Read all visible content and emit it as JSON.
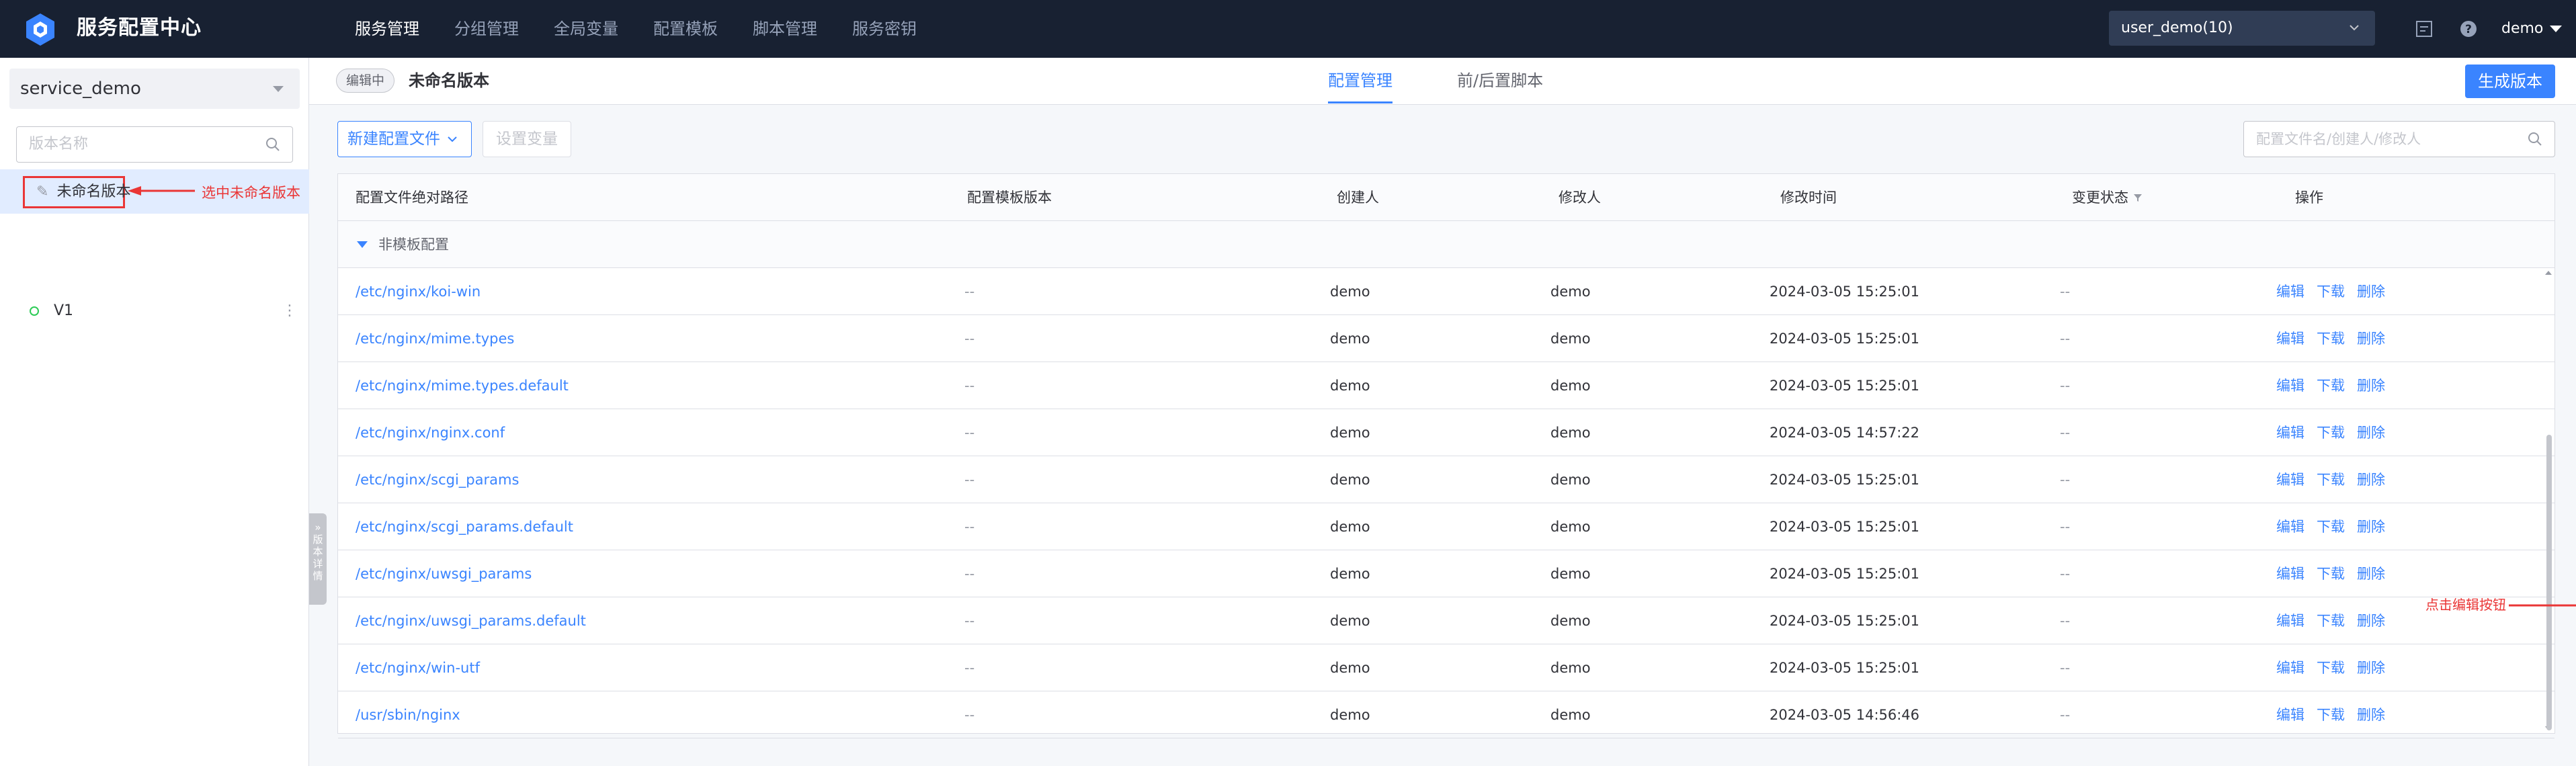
{
  "app": {
    "title": "服务配置中心"
  },
  "nav": {
    "items": [
      "服务管理",
      "分组管理",
      "全局变量",
      "配置模板",
      "脚本管理",
      "服务密钥"
    ],
    "active_index": 0
  },
  "topbar": {
    "business": "user_demo(10)",
    "user": "demo",
    "icons": [
      "doc-icon",
      "help-icon"
    ]
  },
  "sidebar": {
    "service": "service_demo",
    "search_placeholder": "版本名称",
    "versions": [
      {
        "name": "未命名版本",
        "selected": true,
        "icon": "edit-icon"
      },
      {
        "name": "V1",
        "selected": false,
        "icon": "status-dot-icon"
      }
    ],
    "annotation": "选中未命名版本",
    "collapse_label": "» 版 本 详 情"
  },
  "header": {
    "status_tag": "编辑中",
    "version_name": "未命名版本",
    "tabs": [
      "配置管理",
      "前/后置脚本"
    ],
    "active_tab": 0,
    "generate_button": "生成版本"
  },
  "toolbar": {
    "new_config": "新建配置文件",
    "set_variables": "设置变量",
    "search_placeholder": "配置文件名/创建人/修改人"
  },
  "table": {
    "columns": [
      "配置文件绝对路径",
      "配置模板版本",
      "创建人",
      "修改人",
      "修改时间",
      "变更状态",
      "操作"
    ],
    "group_label": "非模板配置",
    "actions": [
      "编辑",
      "下载",
      "删除"
    ],
    "rows": [
      {
        "path": "/etc/nginx/koi-win",
        "template": "--",
        "creator": "demo",
        "modifier": "demo",
        "time": "2024-03-05 15:25:01",
        "status": "--"
      },
      {
        "path": "/etc/nginx/mime.types",
        "template": "--",
        "creator": "demo",
        "modifier": "demo",
        "time": "2024-03-05 15:25:01",
        "status": "--"
      },
      {
        "path": "/etc/nginx/mime.types.default",
        "template": "--",
        "creator": "demo",
        "modifier": "demo",
        "time": "2024-03-05 15:25:01",
        "status": "--"
      },
      {
        "path": "/etc/nginx/nginx.conf",
        "template": "--",
        "creator": "demo",
        "modifier": "demo",
        "time": "2024-03-05 14:57:22",
        "status": "--"
      },
      {
        "path": "/etc/nginx/scgi_params",
        "template": "--",
        "creator": "demo",
        "modifier": "demo",
        "time": "2024-03-05 15:25:01",
        "status": "--"
      },
      {
        "path": "/etc/nginx/scgi_params.default",
        "template": "--",
        "creator": "demo",
        "modifier": "demo",
        "time": "2024-03-05 15:25:01",
        "status": "--"
      },
      {
        "path": "/etc/nginx/uwsgi_params",
        "template": "--",
        "creator": "demo",
        "modifier": "demo",
        "time": "2024-03-05 15:25:01",
        "status": "--"
      },
      {
        "path": "/etc/nginx/uwsgi_params.default",
        "template": "--",
        "creator": "demo",
        "modifier": "demo",
        "time": "2024-03-05 15:25:01",
        "status": "--"
      },
      {
        "path": "/etc/nginx/win-utf",
        "template": "--",
        "creator": "demo",
        "modifier": "demo",
        "time": "2024-03-05 15:25:01",
        "status": "--"
      },
      {
        "path": "/usr/sbin/nginx",
        "template": "--",
        "creator": "demo",
        "modifier": "demo",
        "time": "2024-03-05 14:56:46",
        "status": "--"
      }
    ],
    "annotation": "点击编辑按钮"
  },
  "colors": {
    "primary": "#3a84ff",
    "topbar": "#182132",
    "annotation": "#ea3636",
    "success": "#2dcb56"
  }
}
